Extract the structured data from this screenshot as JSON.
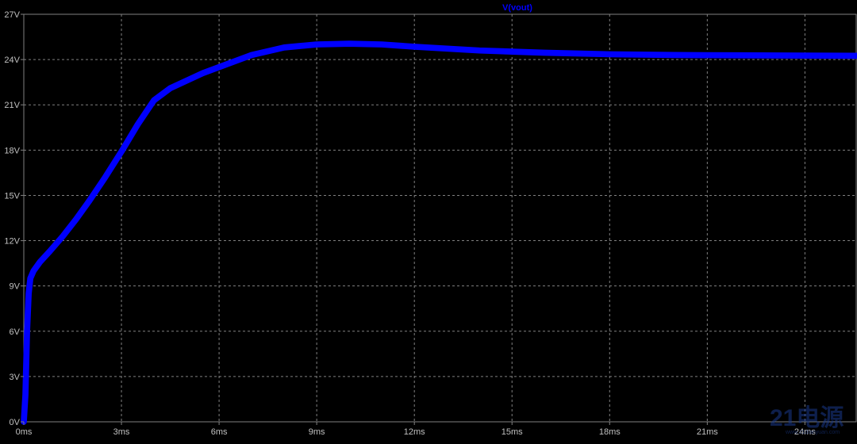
{
  "chart_data": {
    "type": "line",
    "title": "",
    "xlabel": "",
    "ylabel": "",
    "xlim": [
      0,
      25.6
    ],
    "ylim": [
      0,
      27
    ],
    "x_unit": "ms",
    "y_unit": "V",
    "x_ticks": [
      0,
      3,
      6,
      9,
      12,
      15,
      18,
      21,
      24
    ],
    "x_tick_labels": [
      "0ms",
      "3ms",
      "6ms",
      "9ms",
      "12ms",
      "15ms",
      "18ms",
      "21ms",
      "24ms"
    ],
    "y_ticks": [
      0,
      3,
      6,
      9,
      12,
      15,
      18,
      21,
      24,
      27
    ],
    "y_tick_labels": [
      "0V",
      "3V",
      "6V",
      "9V",
      "12V",
      "15V",
      "18V",
      "21V",
      "24V",
      "27V"
    ],
    "grid": true,
    "series": [
      {
        "name": "V(vout)",
        "color": "#0000ff",
        "ripple_band_v": 0.3,
        "x": [
          0,
          0.05,
          0.1,
          0.15,
          0.2,
          0.3,
          0.5,
          0.8,
          1.2,
          1.6,
          2.0,
          2.5,
          3.0,
          3.5,
          4.0,
          4.5,
          5.0,
          5.5,
          6.0,
          7.0,
          8.0,
          9.0,
          10.0,
          11.0,
          12.0,
          14.0,
          16.0,
          18.0,
          20.0,
          22.0,
          24.0,
          25.6
        ],
        "y": [
          0,
          1.8,
          6.0,
          8.5,
          9.5,
          10.0,
          10.6,
          11.3,
          12.3,
          13.4,
          14.6,
          16.2,
          17.9,
          19.7,
          21.3,
          22.1,
          22.6,
          23.1,
          23.5,
          24.3,
          24.8,
          25.0,
          25.05,
          25.0,
          24.85,
          24.6,
          24.45,
          24.35,
          24.3,
          24.28,
          24.26,
          24.25
        ]
      }
    ]
  },
  "watermark": {
    "main_text": "21电源",
    "sub_text": "www.21dianyuan.com",
    "color": "#1a3a8a"
  },
  "colors": {
    "background": "#000000",
    "grid": "#808080",
    "axis": "#808080",
    "tick_text": "#c0c0c0"
  }
}
